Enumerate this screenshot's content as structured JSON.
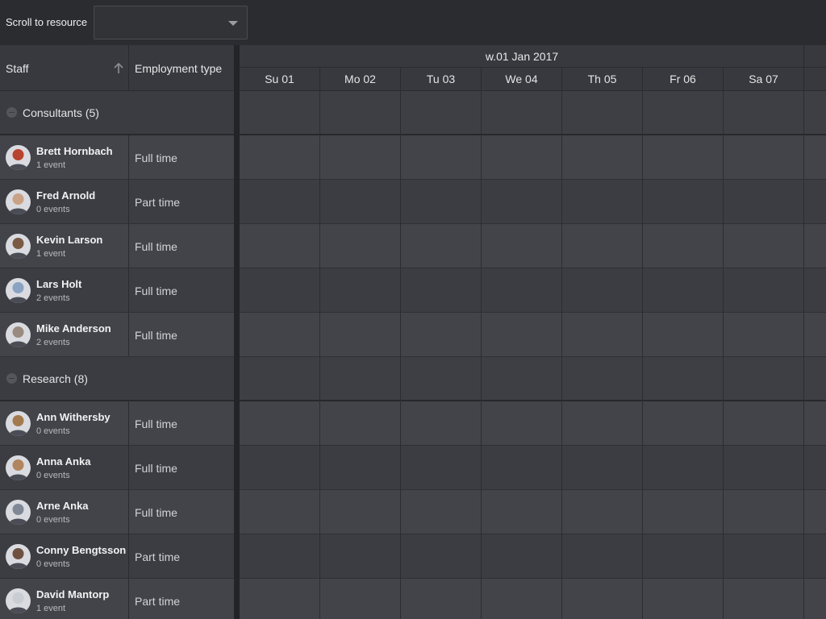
{
  "toolbar": {
    "scroll_label": "Scroll to resource",
    "combo_value": ""
  },
  "grid": {
    "col_staff": "Staff",
    "col_employment": "Employment type"
  },
  "timeline": {
    "week_label": "w.01 Jan 2017",
    "days": [
      "Su 01",
      "Mo 02",
      "Tu 03",
      "We 04",
      "Th 05",
      "Fr 06",
      "Sa 07"
    ]
  },
  "groups": [
    {
      "label": "Consultants (5)",
      "rows": [
        {
          "name": "Brett Hornbach",
          "events": "1 event",
          "employment": "Full time",
          "avatar_color": "#b8432f"
        },
        {
          "name": "Fred Arnold",
          "events": "0 events",
          "employment": "Part time",
          "avatar_color": "#c9a184"
        },
        {
          "name": "Kevin Larson",
          "events": "1 event",
          "employment": "Full time",
          "avatar_color": "#7a5a45"
        },
        {
          "name": "Lars Holt",
          "events": "2 events",
          "employment": "Full time",
          "avatar_color": "#8aa3c2"
        },
        {
          "name": "Mike Anderson",
          "events": "2 events",
          "employment": "Full time",
          "avatar_color": "#9a8b80"
        }
      ]
    },
    {
      "label": "Research (8)",
      "rows": [
        {
          "name": "Ann Withersby",
          "events": "0 events",
          "employment": "Full time",
          "avatar_color": "#a37a4e"
        },
        {
          "name": "Anna Anka",
          "events": "0 events",
          "employment": "Full time",
          "avatar_color": "#b08560"
        },
        {
          "name": "Arne Anka",
          "events": "0 events",
          "employment": "Full time",
          "avatar_color": "#7f8895"
        },
        {
          "name": "Conny Bengtsson",
          "events": "0 events",
          "employment": "Part time",
          "avatar_color": "#6e5140"
        },
        {
          "name": "David Mantorp",
          "events": "1 event",
          "employment": "Part time",
          "avatar_color": "#c8ccd3"
        }
      ]
    }
  ]
}
